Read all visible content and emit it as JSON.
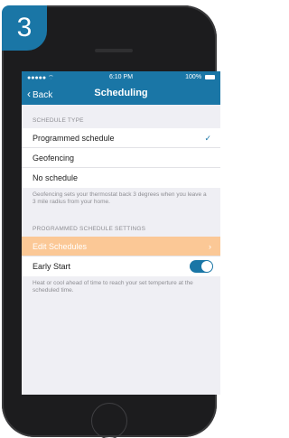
{
  "step": {
    "number": "3"
  },
  "status_bar": {
    "signal": "●●●●● ⌔",
    "time": "6:10 PM",
    "battery": "100%"
  },
  "nav": {
    "back_label": "Back",
    "title": "Scheduling"
  },
  "schedule_type": {
    "header": "SCHEDULE TYPE",
    "options": [
      {
        "label": "Programmed schedule",
        "selected": true
      },
      {
        "label": "Geofencing",
        "selected": false
      },
      {
        "label": "No schedule",
        "selected": false
      }
    ],
    "note": "Geofencing sets your thermostat back 3 degrees when you leave a 3 mile radius from your home."
  },
  "programmed_settings": {
    "header": "PROGRAMMED SCHEDULE SETTINGS",
    "edit_label": "Edit Schedules",
    "early_start_label": "Early Start",
    "early_start_on": true,
    "note": "Heat or cool ahead of time to reach your set temperture at the scheduled time."
  },
  "colors": {
    "brand_blue": "#1a76a6",
    "highlight_orange": "#fbc896"
  }
}
